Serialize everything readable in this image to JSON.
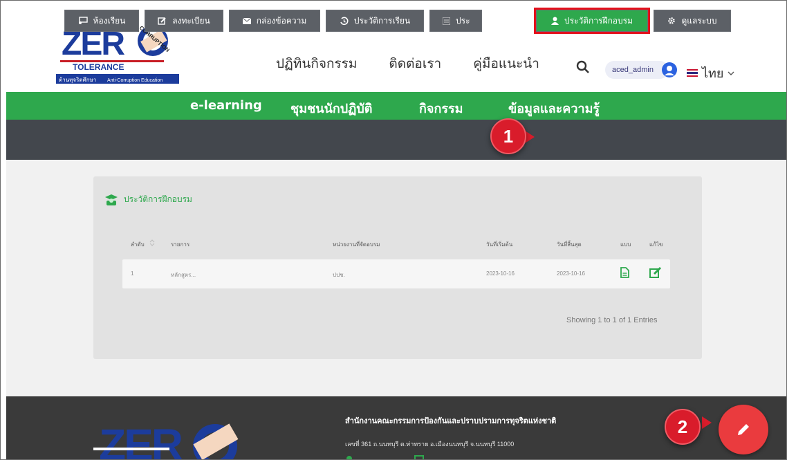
{
  "logo": {
    "text_zero": "ZER",
    "text_tolerance": "TOLERANCE",
    "text_tagline": "ต้านทุจริตศึกษา",
    "text_sub": "Anti-Corruption Education",
    "stamp": "CORRUPTION"
  },
  "top_nav": {
    "items": [
      "ปฏิทินกิจกรรม",
      "ติดต่อเรา",
      "คู่มือแนะนำ"
    ]
  },
  "user": {
    "name": "aced_admin"
  },
  "language": {
    "label": "ไทย"
  },
  "green_nav": {
    "items": [
      "e-learning",
      "ชุมชนนักปฏิบัติ",
      "กิจกรรม",
      "ข้อมูลและความรู้"
    ]
  },
  "tabs": [
    {
      "label": "ห้องเรียน",
      "icon": "classroom-icon"
    },
    {
      "label": "ลงทะเบียน",
      "icon": "edit-icon"
    },
    {
      "label": "กล่องข้อความ",
      "icon": "envelope-icon"
    },
    {
      "label": "ประวัติการเรียน",
      "icon": "history-icon"
    },
    {
      "label": "ประ",
      "icon": "list-icon"
    },
    {
      "label": "ประวัติการฝึกอบรม",
      "icon": "user-icon"
    },
    {
      "label": "ดูแลระบบ",
      "icon": "gear-icon"
    }
  ],
  "badges": {
    "first": "1",
    "second": "2"
  },
  "card": {
    "title": "ประวัติการฝึกอบรม",
    "columns": [
      "ลำดับ",
      "รายการ",
      "หน่วยงานที่จัดอบรม",
      "วันที่เริ่มต้น",
      "วันที่สิ้นสุด",
      "แบบ",
      "แก้ไข"
    ],
    "rows": [
      {
        "no": "1",
        "item": "หลักสูตร...",
        "agency": "ปปช.",
        "start": "2023-10-16",
        "end": "2023-10-16"
      }
    ],
    "showing": "Showing 1 to 1 of 1 Entries"
  },
  "footer": {
    "title": "สำนักงานคณะกรรมการป้องกันและปราบปรามการทุจริตแห่งชาติ",
    "address": "เลขที่ 361 ถ.นนทบุรี ต.ท่าทราย อ.เมืองนนทบุรี จ.นนทบุรี 11000"
  },
  "colors": {
    "brand_green": "#2ea84d",
    "dark_bar": "#43474d",
    "badge_red": "#d91c2b",
    "fab_red": "#ea3b3e"
  }
}
